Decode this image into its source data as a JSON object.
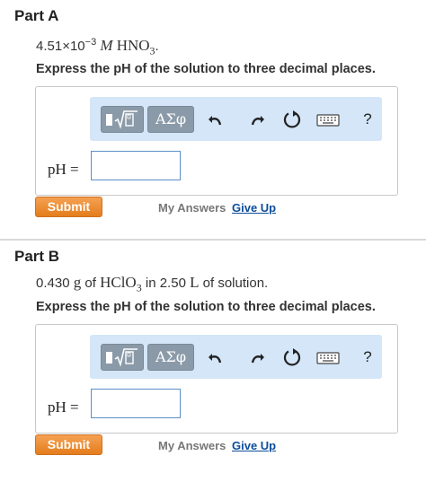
{
  "colors": {
    "toolbar_bg": "#d4e6f8",
    "toolbar_button": "#8b9aa8",
    "submit": "#e8862a",
    "link": "#0c4d9a",
    "input_border": "#5b8fc7"
  },
  "toolbar": {
    "templates_icon": "templates-icon",
    "greek_label": "ΑΣφ",
    "undo_icon": "undo-icon",
    "redo_icon": "redo-icon",
    "reset_icon": "reset-icon",
    "keyboard_icon": "keyboard-icon",
    "help_label": "?"
  },
  "parts": [
    {
      "title": "Part A",
      "question": {
        "amount": "4.51×10",
        "exponent": "−3",
        "unit": "M",
        "formula": "HNO",
        "subscript": "3",
        "end": "."
      },
      "instruction": "Express the pH of the solution to three decimal places.",
      "answer_label": "pH =",
      "answer_value": "",
      "submit_label": "Submit",
      "my_answers_label": "My Answers",
      "give_up_label": "Give Up"
    },
    {
      "title": "Part B",
      "question": {
        "amount": "0.430",
        "unit1": "g",
        "of": "of",
        "formula": "HClO",
        "subscript": "3",
        "middle": "in 2.50",
        "unit2": "L",
        "end": "of solution."
      },
      "instruction": "Express the pH of the solution to three decimal places.",
      "answer_label": "pH =",
      "answer_value": "",
      "submit_label": "Submit",
      "my_answers_label": "My Answers",
      "give_up_label": "Give Up"
    }
  ]
}
